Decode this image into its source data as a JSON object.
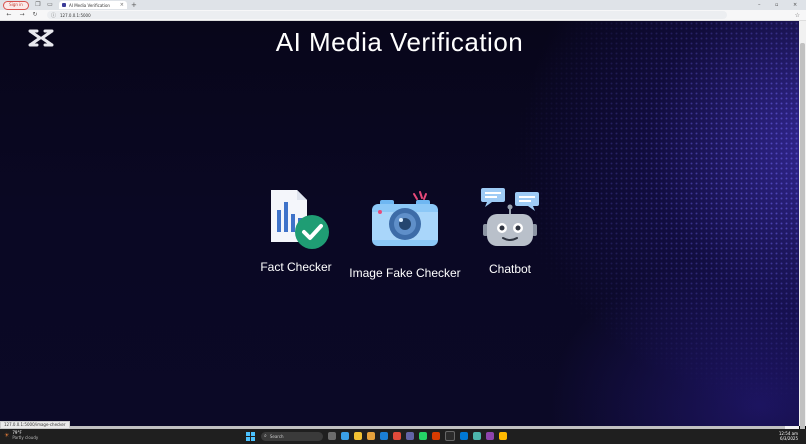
{
  "browser": {
    "profile_label": "Sign in",
    "tab_title": "AI Media Verification",
    "url": "127.0.0.1:5000",
    "status_url": "127.0.0.1:5000/image-checker"
  },
  "page": {
    "title": "AI Media Verification",
    "features": [
      {
        "label": "Fact Checker",
        "icon": "document-check-icon"
      },
      {
        "label": "Image Fake Checker",
        "icon": "camera-icon"
      },
      {
        "label": "Chatbot",
        "icon": "robot-icon"
      }
    ]
  },
  "taskbar": {
    "weather_temp": "79°F",
    "weather_cond": "Partly cloudy",
    "search_placeholder": "Search",
    "time": "12:54 am",
    "date": "6/3/2025"
  }
}
